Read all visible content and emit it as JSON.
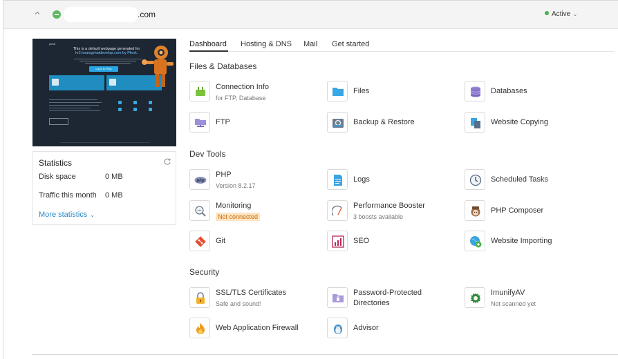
{
  "header": {
    "domain_suffix": ".com",
    "status": "Active"
  },
  "tabs": [
    "Dashboard",
    "Hosting & DNS",
    "Mail",
    "Get started"
  ],
  "preview": {
    "logo": "plesk",
    "title_line1": "This is a default webpage generated for",
    "title_line2": "hr2.hoangphatdevelop.com by Plesk.",
    "button": "Log in to Plesk"
  },
  "statistics": {
    "title": "Statistics",
    "rows": [
      {
        "label": "Disk space",
        "value": "0 MB"
      },
      {
        "label": "Traffic this month",
        "value": "0 MB"
      }
    ],
    "more": "More statistics"
  },
  "sections": {
    "files": {
      "title": "Files & Databases",
      "items": [
        {
          "label": "Connection Info",
          "sub": "for FTP, Database",
          "icon": "plug-icon"
        },
        {
          "label": "Files",
          "icon": "folder-icon"
        },
        {
          "label": "Databases",
          "icon": "database-icon"
        },
        {
          "label": "FTP",
          "icon": "ftp-icon"
        },
        {
          "label": "Backup & Restore",
          "icon": "backup-icon"
        },
        {
          "label": "Website Copying",
          "icon": "copy-icon"
        }
      ]
    },
    "dev": {
      "title": "Dev Tools",
      "items": [
        {
          "label": "PHP",
          "sub": "Version 8.2.17",
          "icon": "php-icon"
        },
        {
          "label": "Logs",
          "icon": "logs-icon"
        },
        {
          "label": "Scheduled Tasks",
          "icon": "clock-icon"
        },
        {
          "label": "Monitoring",
          "badge": "Not connected",
          "icon": "monitoring-icon"
        },
        {
          "label": "Performance Booster",
          "sub": "3 boosts available",
          "icon": "gauge-icon"
        },
        {
          "label": "PHP Composer",
          "icon": "composer-icon"
        },
        {
          "label": "Git",
          "icon": "git-icon"
        },
        {
          "label": "SEO",
          "icon": "seo-chart-icon"
        },
        {
          "label": "Website Importing",
          "icon": "import-icon"
        }
      ]
    },
    "security": {
      "title": "Security",
      "items": [
        {
          "label": "SSL/TLS Certificates",
          "sub": "Safe and sound!",
          "icon": "lock-icon"
        },
        {
          "label": "Password-Protected",
          "label2": "Directories",
          "icon": "protected-folder-icon"
        },
        {
          "label": "ImunifyAV",
          "sub": "Not scanned yet",
          "icon": "imunify-icon"
        },
        {
          "label": "Web Application Firewall",
          "icon": "flame-icon"
        },
        {
          "label": "Advisor",
          "icon": "advisor-penguin-icon"
        }
      ]
    }
  }
}
